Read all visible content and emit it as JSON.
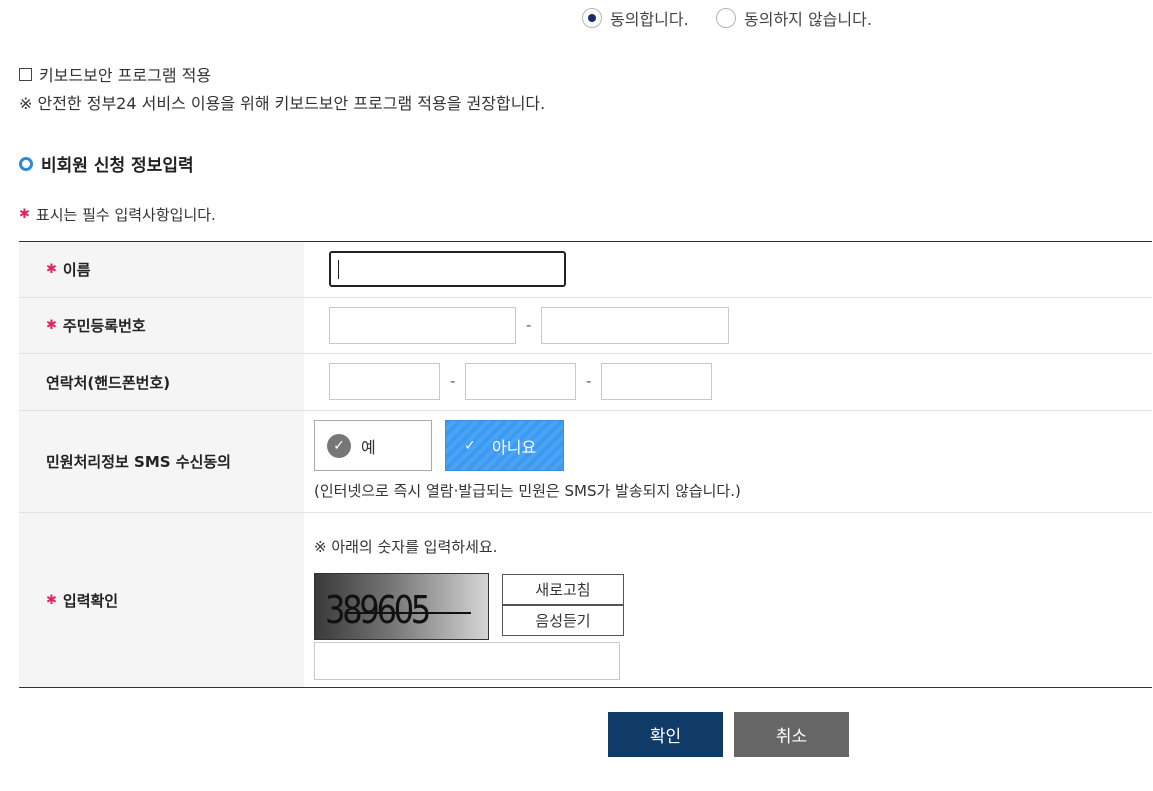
{
  "consent": {
    "agree_label": "동의합니다.",
    "disagree_label": "동의하지 않습니다.",
    "selected": "agree"
  },
  "keyboard_security": {
    "checkbox_label": "키보드보안 프로그램 적용",
    "checked": false,
    "note": "※ 안전한 정부24 서비스 이용을 위해 키보드보안 프로그램 적용을 권장합니다."
  },
  "section": {
    "title": "비회원 신청 정보입력",
    "required_note": "표시는 필수 입력사항입니다.",
    "required_mark": "✱"
  },
  "form": {
    "name_label": "이름",
    "name_value": "",
    "rrn_label": "주민등록번호",
    "rrn_front": "",
    "rrn_back": "",
    "phone_label": "연락처(핸드폰번호)",
    "phone_1": "",
    "phone_2": "",
    "phone_3": "",
    "separator": "-",
    "sms_label": "민원처리정보 SMS 수신동의",
    "sms_yes": "예",
    "sms_no": "아니요",
    "sms_selected": "no",
    "sms_note": "(인터넷으로 즉시 열람·발급되는 민원은 SMS가 발송되지 않습니다.)",
    "captcha_label": "입력확인",
    "captcha_note": "※ 아래의 숫자를 입력하세요.",
    "captcha_text": "389605",
    "refresh_label": "새로고침",
    "audio_label": "음성듣기",
    "captcha_value": ""
  },
  "buttons": {
    "confirm": "확인",
    "cancel": "취소"
  },
  "colors": {
    "primary": "#103a68",
    "accent_blue": "#3d9af0",
    "required_red": "#e0245e",
    "cancel_gray": "#666666"
  }
}
